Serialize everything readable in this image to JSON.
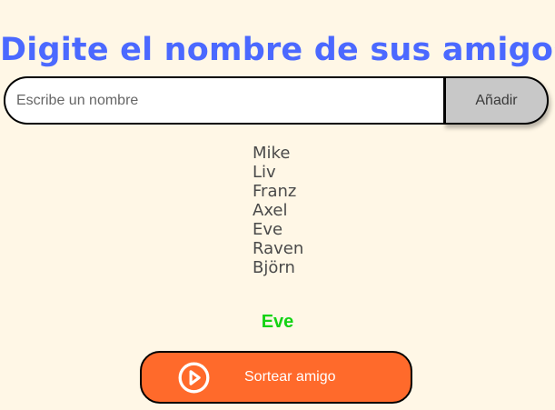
{
  "header": {
    "title": "Digite el nombre de sus amigos"
  },
  "form": {
    "input": {
      "placeholder": "Escribe un nombre",
      "value": ""
    },
    "add_button_label": "Añadir"
  },
  "friends": [
    "Mike",
    "Liv",
    "Franz",
    "Axel",
    "Eve",
    "Raven",
    "Björn"
  ],
  "result": {
    "selected_friend": "Eve"
  },
  "draw_button": {
    "label": "Sortear amigo",
    "icon": "play-circle-icon"
  },
  "colors": {
    "background": "#fff7e6",
    "title": "#4b69ff",
    "result": "#13d313",
    "draw_button": "#ff6a2b",
    "add_button": "#c8c8c8"
  }
}
